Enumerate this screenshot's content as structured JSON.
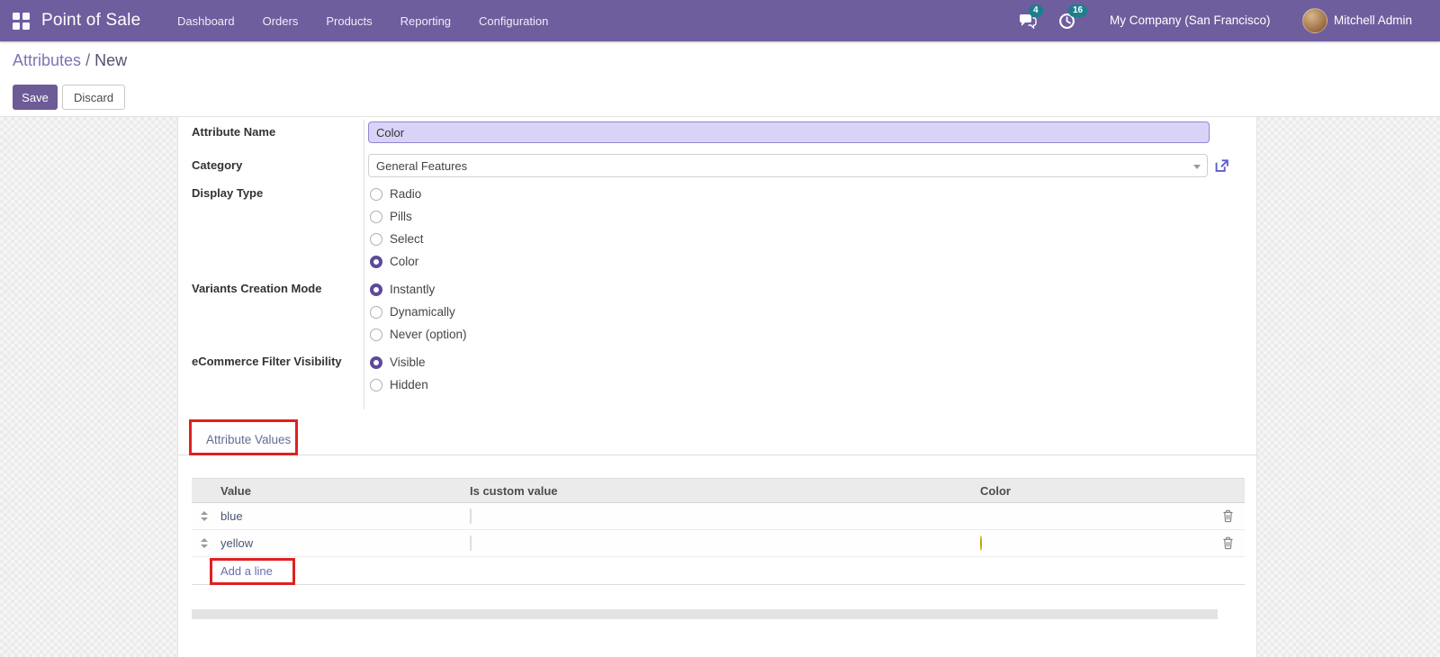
{
  "navbar": {
    "brand": "Point of Sale",
    "menus": [
      {
        "label": "Dashboard"
      },
      {
        "label": "Orders"
      },
      {
        "label": "Products"
      },
      {
        "label": "Reporting"
      },
      {
        "label": "Configuration"
      }
    ],
    "messages_badge": "4",
    "activities_badge": "16",
    "company": "My Company (San Francisco)",
    "user": "Mitchell Admin"
  },
  "control_panel": {
    "breadcrumb_parent": "Attributes",
    "breadcrumb_separator": "/",
    "breadcrumb_current": "New",
    "save_label": "Save",
    "discard_label": "Discard"
  },
  "form": {
    "attribute_name": {
      "label": "Attribute Name",
      "value": "Color"
    },
    "category": {
      "label": "Category",
      "value": "General Features"
    },
    "display_type": {
      "label": "Display Type",
      "options": [
        {
          "label": "Radio",
          "selected": false
        },
        {
          "label": "Pills",
          "selected": false
        },
        {
          "label": "Select",
          "selected": false
        },
        {
          "label": "Color",
          "selected": true
        }
      ]
    },
    "variants_mode": {
      "label": "Variants Creation Mode",
      "options": [
        {
          "label": "Instantly",
          "selected": true
        },
        {
          "label": "Dynamically",
          "selected": false
        },
        {
          "label": "Never (option)",
          "selected": false
        }
      ]
    },
    "ecommerce_visibility": {
      "label": "eCommerce Filter Visibility",
      "options": [
        {
          "label": "Visible",
          "selected": true
        },
        {
          "label": "Hidden",
          "selected": false
        }
      ]
    }
  },
  "notebook": {
    "tab": "Attribute Values"
  },
  "values_table": {
    "headers": {
      "value": "Value",
      "is_custom": "Is custom value",
      "color": "Color"
    },
    "rows": [
      {
        "value": "blue",
        "color": "#1166e0",
        "color_css": "background:#1166e0"
      },
      {
        "value": "yellow",
        "color": "#f1ef2e",
        "color_css": "background:#f1ef2e;border:1px solid #b8a80a"
      }
    ],
    "add_line_label": "Add a line"
  },
  "icons": {
    "apps": "grid-icon",
    "messages": "chat-bubble-icon",
    "activities": "clock-icon",
    "category_dropdown": "caret-down-icon",
    "category_open": "external-link-icon",
    "row_drag": "drag-handle-icon",
    "row_delete": "trash-icon"
  },
  "colors": {
    "navbar": "#6e5e9e",
    "accent": "#6c5b96",
    "badge": "#1b7f8d",
    "annotation_red": "#e02020",
    "focused_input_bg": "#d9d4f7",
    "blue_dot": "#1166e0",
    "yellow_dot": "#f1ef2e"
  }
}
